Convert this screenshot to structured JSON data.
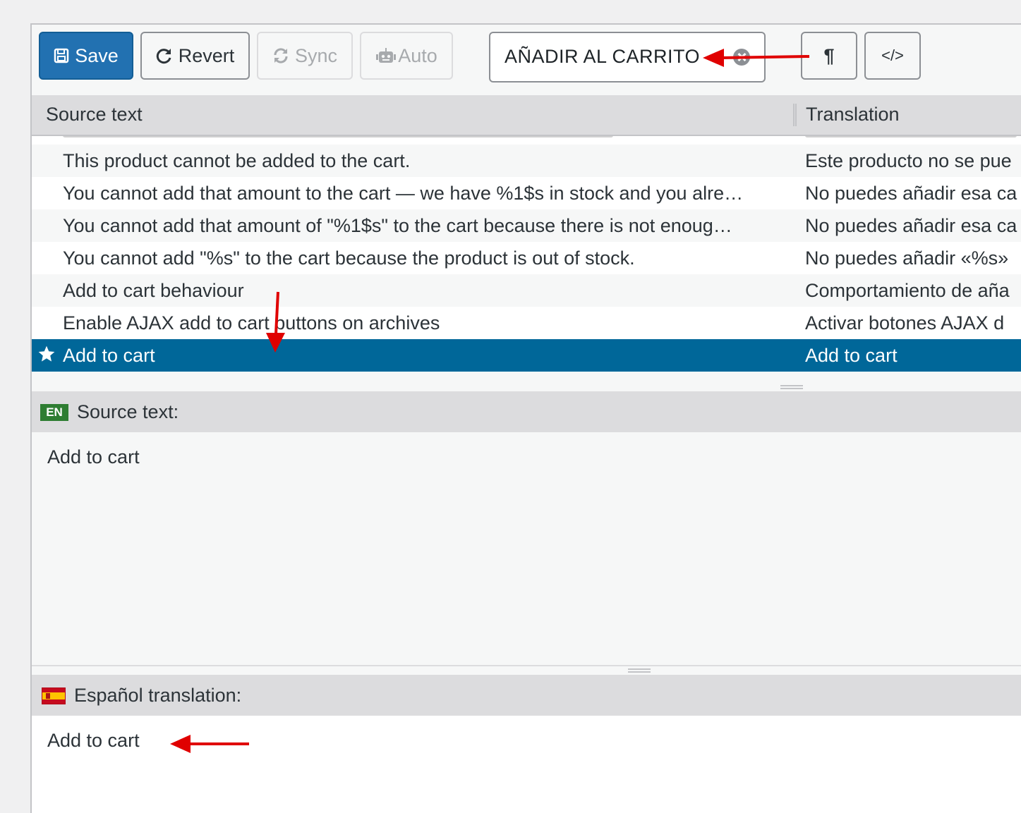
{
  "toolbar": {
    "save_label": "Save",
    "revert_label": "Revert",
    "sync_label": "Sync",
    "auto_label": "Auto",
    "search_value": "AÑADIR AL CARRITO",
    "pilcrow_label": "¶",
    "code_label": "</>"
  },
  "list": {
    "header_source": "Source text",
    "header_translation": "Translation",
    "rows": [
      {
        "source": "This product cannot be added to the cart.",
        "translation": "Este producto no se pue"
      },
      {
        "source": "You cannot add that amount to the cart — we have %1$s in stock and you alre…",
        "translation": "No puedes añadir esa ca"
      },
      {
        "source": "You cannot add that amount of \"%1$s\" to the cart because there is not enoug…",
        "translation": "No puedes añadir esa ca"
      },
      {
        "source": "You cannot add \"%s\" to the cart because the product is out of stock.",
        "translation": "No puedes añadir «%s»"
      },
      {
        "source": "Add to cart behaviour",
        "translation": "Comportamiento de aña"
      },
      {
        "source": "Enable AJAX add to cart buttons on archives",
        "translation": "Activar botones AJAX d"
      },
      {
        "source": "Add to cart",
        "translation": "Add to cart",
        "selected": true
      }
    ]
  },
  "source_pane": {
    "badge": "EN",
    "label": "Source text:",
    "text": "Add to cart"
  },
  "translation_pane": {
    "label": "Español translation:",
    "text": "Add to cart"
  },
  "colors": {
    "primary": "#2271b1",
    "selected_row": "#006799",
    "annotation_arrow": "#e00000"
  }
}
